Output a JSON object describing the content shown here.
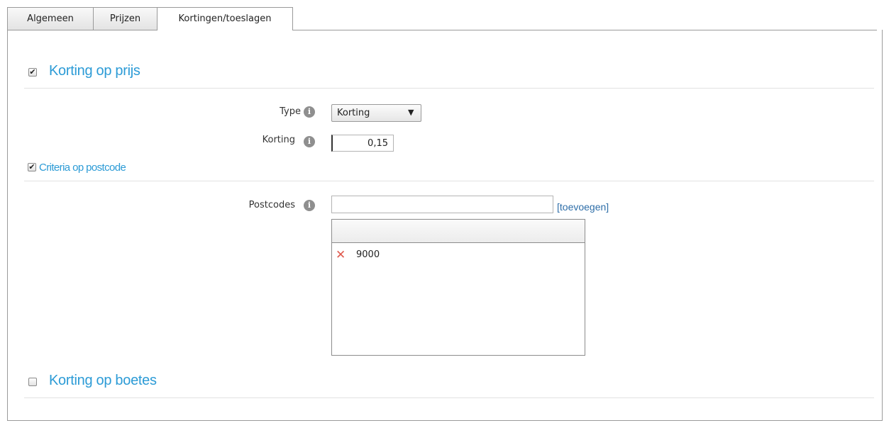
{
  "tabs": [
    {
      "label": "Algemeen"
    },
    {
      "label": "Prijzen"
    },
    {
      "label": "Kortingen/toeslagen"
    }
  ],
  "sections": {
    "korting_prijs": {
      "title": "Korting op prijs",
      "checked": true
    },
    "criteria_postcode": {
      "title": "Criteria op postcode",
      "checked": true
    },
    "korting_boetes": {
      "title": "Korting op boetes",
      "checked": false
    }
  },
  "form": {
    "type": {
      "label": "Type",
      "value": "Korting"
    },
    "korting": {
      "label": "Korting",
      "value": "0,15"
    },
    "postcodes": {
      "label": "Postcodes",
      "input_value": "",
      "add_link": "[toevoegen]",
      "list": [
        "9000"
      ]
    }
  },
  "icons": {
    "info": "info-icon",
    "remove": "remove-x-icon",
    "dropdown": "caret-down-icon",
    "check": "checkmark-icon"
  },
  "colors": {
    "accent": "#2c9bd6",
    "link": "#2e6ea8",
    "remove": "#e05a4e"
  }
}
